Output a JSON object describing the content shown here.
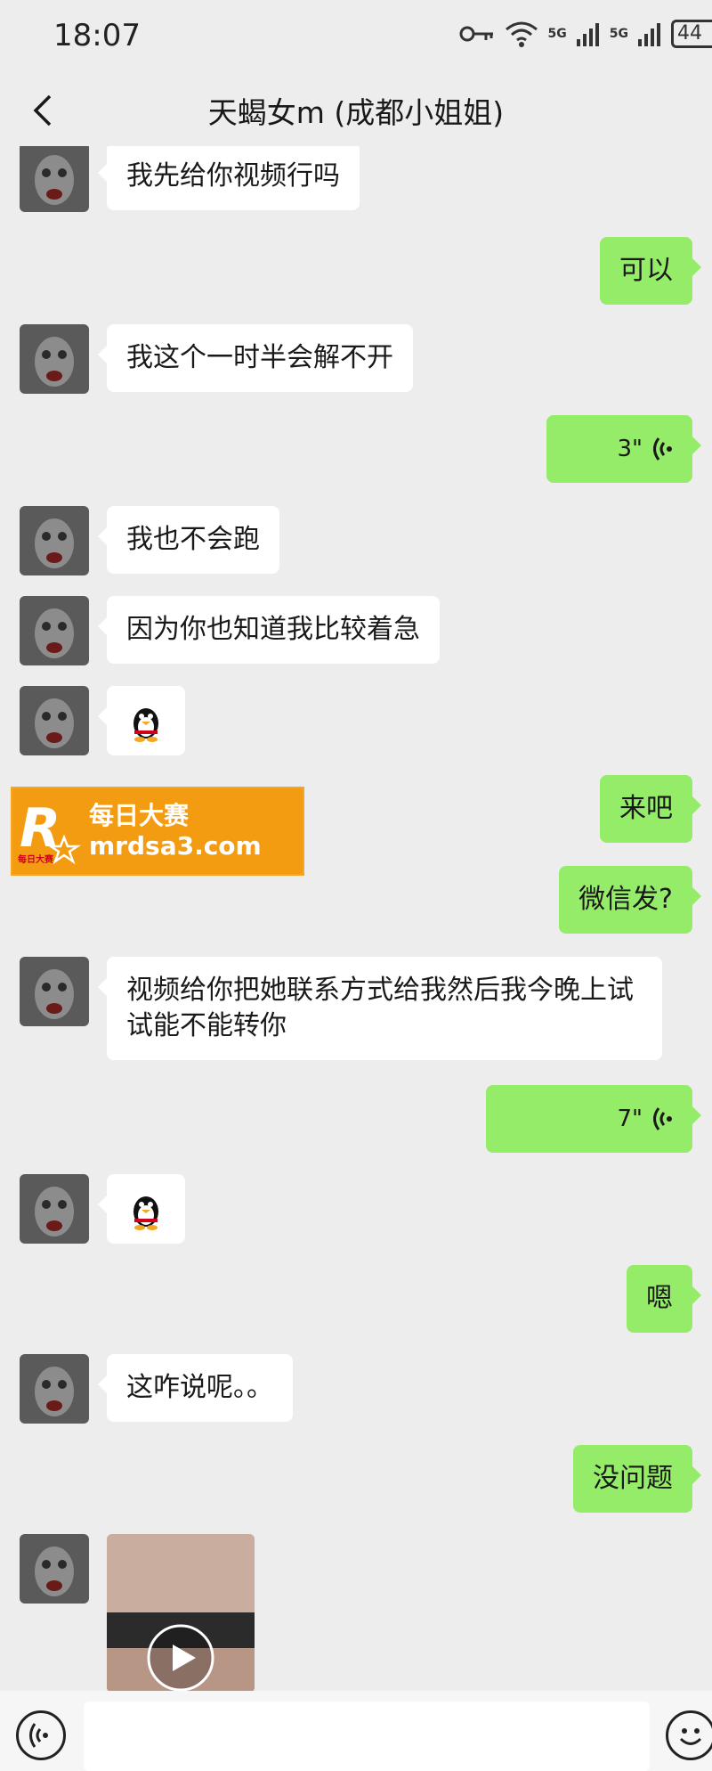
{
  "status_bar": {
    "time": "18:07",
    "network_1": "5G",
    "network_2": "5G",
    "battery": "44"
  },
  "header": {
    "title": "天蝎女m (成都小姐姐)"
  },
  "messages": [
    {
      "side": "left",
      "type": "text",
      "text": "我先给你视频行吗"
    },
    {
      "side": "right",
      "type": "text",
      "text": "可以"
    },
    {
      "side": "left",
      "type": "text",
      "text": "我这个一时半会解不开"
    },
    {
      "side": "right",
      "type": "voice",
      "duration": "3\""
    },
    {
      "side": "left",
      "type": "text",
      "text": "我也不会跑"
    },
    {
      "side": "left",
      "type": "text",
      "text": "因为你也知道我比较着急"
    },
    {
      "side": "left",
      "type": "sticker",
      "sticker": "qq-penguin"
    },
    {
      "side": "right",
      "type": "text",
      "text": "来吧"
    },
    {
      "side": "right",
      "type": "text",
      "text": "微信发?"
    },
    {
      "side": "left",
      "type": "text",
      "text": "视频给你把她联系方式给我然后我今晚上试试能不能转你"
    },
    {
      "side": "right",
      "type": "voice",
      "duration": "7\""
    },
    {
      "side": "left",
      "type": "sticker",
      "sticker": "qq-penguin"
    },
    {
      "side": "right",
      "type": "text",
      "text": "嗯"
    },
    {
      "side": "left",
      "type": "text",
      "text": "这咋说呢。。"
    },
    {
      "side": "right",
      "type": "text",
      "text": "没问题"
    },
    {
      "side": "left",
      "type": "video"
    }
  ],
  "watermark": {
    "logo_letter": "R",
    "logo_small": "每日大赛",
    "cn": "每日大赛",
    "url": "mrdsa3.com"
  },
  "input_bar": {
    "placeholder": ""
  },
  "colors": {
    "background": "#ededed",
    "sent_bubble": "#95ec69",
    "received_bubble": "#ffffff",
    "watermark": "#f39c12"
  }
}
